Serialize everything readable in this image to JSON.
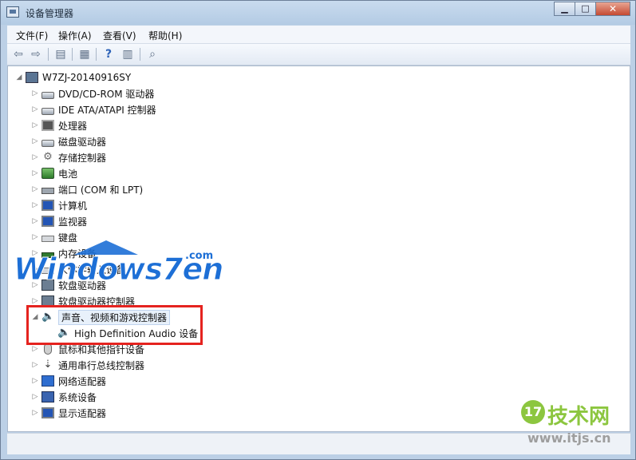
{
  "window": {
    "title": "设备管理器",
    "minimize": "▁",
    "maximize": "□",
    "close": "✕"
  },
  "menu": [
    "文件(F)",
    "操作(A)",
    "查看(V)",
    "帮助(H)"
  ],
  "toolbar_icons": [
    "back-arrow-icon",
    "forward-arrow-icon",
    "show-hide-tree-icon",
    "properties-icon",
    "help-icon",
    "list-view-icon",
    "scan-hardware-icon"
  ],
  "tree": {
    "root": "W7ZJ-20140916SY",
    "items": [
      {
        "label": "DVD/CD-ROM 驱动器",
        "icon": "dvd-drive-icon"
      },
      {
        "label": "IDE ATA/ATAPI 控制器",
        "icon": "ide-controller-icon"
      },
      {
        "label": "处理器",
        "icon": "processor-icon"
      },
      {
        "label": "磁盘驱动器",
        "icon": "disk-drive-icon"
      },
      {
        "label": "存储控制器",
        "icon": "storage-controller-icon"
      },
      {
        "label": "电池",
        "icon": "battery-icon"
      },
      {
        "label": "端口 (COM 和 LPT)",
        "icon": "port-icon"
      },
      {
        "label": "计算机",
        "icon": "computer-icon"
      },
      {
        "label": "监视器",
        "icon": "monitor-icon"
      },
      {
        "label": "键盘",
        "icon": "keyboard-icon"
      },
      {
        "label": "内存设备",
        "icon": "memory-icon"
      },
      {
        "label": "人体学输入设备",
        "icon": "hid-icon"
      },
      {
        "label": "软盘驱动器",
        "icon": "floppy-drive-icon"
      },
      {
        "label": "软盘驱动器控制器",
        "icon": "floppy-controller-icon"
      },
      {
        "label": "声音、视频和游戏控制器",
        "icon": "speaker-icon",
        "expanded": true,
        "children": [
          {
            "label": "High Definition Audio 设备",
            "icon": "speaker-icon"
          }
        ]
      },
      {
        "label": "鼠标和其他指针设备",
        "icon": "mouse-icon"
      },
      {
        "label": "通用串行总线控制器",
        "icon": "usb-icon"
      },
      {
        "label": "网络适配器",
        "icon": "network-adapter-icon"
      },
      {
        "label": "系统设备",
        "icon": "system-device-icon"
      },
      {
        "label": "显示适配器",
        "icon": "display-adapter-icon"
      }
    ]
  },
  "watermark": {
    "brand": "Windows7en",
    "suffix": ".com"
  },
  "site_logo": {
    "number": "17",
    "name": "技术网",
    "url": "www.itjs.cn"
  },
  "colors": {
    "highlight": "#e5231f",
    "watermark_blue": "#1d6fd6",
    "logo_green": "#8cc63f"
  }
}
